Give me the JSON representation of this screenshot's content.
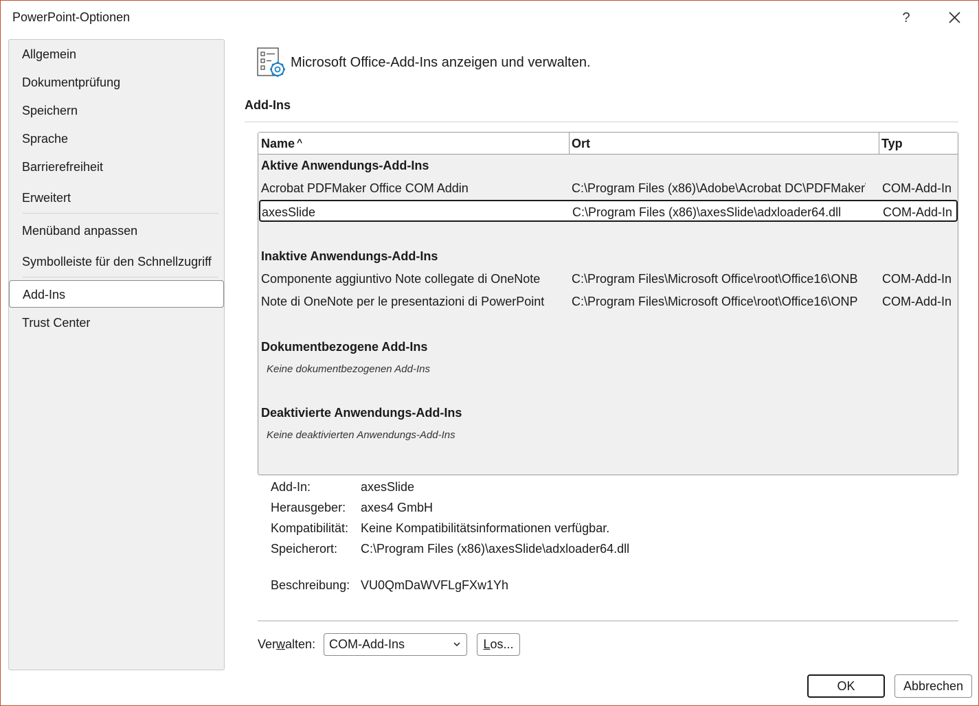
{
  "window": {
    "title": "PowerPoint-Optionen",
    "help_glyph": "?"
  },
  "sidebar": {
    "items": [
      {
        "label": "Allgemein"
      },
      {
        "label": "Dokumentprüfung"
      },
      {
        "label": "Speichern"
      },
      {
        "label": "Sprache"
      },
      {
        "label": "Barrierefreiheit"
      },
      {
        "label": "Erweitert"
      },
      {
        "label": "Menüband anpassen"
      },
      {
        "label": "Symbolleiste für den Schnellzugriff"
      },
      {
        "label": "Add-Ins",
        "selected": true
      },
      {
        "label": "Trust Center"
      }
    ]
  },
  "main": {
    "header_icon": "addins-settings-icon",
    "header_text": "Microsoft Office-Add-Ins anzeigen und verwalten.",
    "section_title": "Add-Ins",
    "table": {
      "columns": {
        "name": "Name",
        "sort_glyph": "^",
        "location": "Ort",
        "type": "Typ"
      },
      "groups": [
        {
          "title": "Aktive Anwendungs-Add-Ins",
          "rows": [
            {
              "name": "Acrobat PDFMaker Office COM Addin",
              "location": "C:\\Program Files (x86)\\Adobe\\Acrobat DC\\PDFMaker\\",
              "type": "COM-Add-In"
            },
            {
              "name": "axesSlide",
              "location": "C:\\Program Files (x86)\\axesSlide\\adxloader64.dll",
              "type": "COM-Add-In",
              "selected": true
            }
          ]
        },
        {
          "title": "Inaktive Anwendungs-Add-Ins",
          "rows": [
            {
              "name": "Componente aggiuntivo Note collegate di OneNote",
              "location": "C:\\Program Files\\Microsoft Office\\root\\Office16\\ONB",
              "type": "COM-Add-In"
            },
            {
              "name": "Note di OneNote per le presentazioni di PowerPoint",
              "location": "C:\\Program Files\\Microsoft Office\\root\\Office16\\ONP",
              "type": "COM-Add-In"
            }
          ]
        },
        {
          "title": "Dokumentbezogene Add-Ins",
          "empty_text": "Keine dokumentbezogenen Add-Ins"
        },
        {
          "title": "Deaktivierte Anwendungs-Add-Ins",
          "empty_text": "Keine deaktivierten Anwendungs-Add-Ins"
        }
      ]
    },
    "details": {
      "addin_label": "Add-In:",
      "addin_value": "axesSlide",
      "publisher_label": "Herausgeber:",
      "publisher_value": "axes4 GmbH",
      "compat_label": "Kompatibilität:",
      "compat_value": "Keine Kompatibilitätsinformationen verfügbar.",
      "location_label": "Speicherort:",
      "location_value": "C:\\Program Files (x86)\\axesSlide\\adxloader64.dll",
      "description_label": "Beschreibung:",
      "description_value": "VU0QmDaWVFLgFXw1Yh"
    },
    "manage": {
      "label_pre": "Ver",
      "label_acc": "w",
      "label_post": "alten:",
      "selected": "COM-Add-Ins",
      "go_acc": "L",
      "go_post": "os..."
    }
  },
  "footer": {
    "ok": "OK",
    "cancel": "Abbrechen"
  },
  "colors": {
    "window_border": "#c4502f",
    "sidebar_bg": "#f0f0f0",
    "table_bg": "#f0f0f0",
    "icon_accent": "#1b7fc4"
  }
}
